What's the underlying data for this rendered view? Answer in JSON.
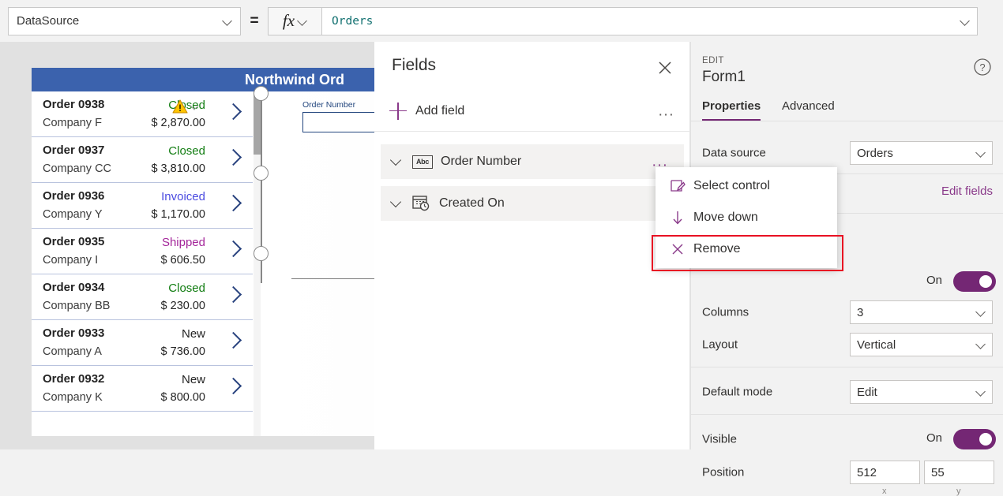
{
  "formula_bar": {
    "property_selector": "DataSource",
    "equals": "=",
    "fx_label": "fx",
    "formula_value": "Orders"
  },
  "canvas": {
    "gallery_title": "Northwind Ord",
    "gallery_rows": [
      {
        "order": "Order 0938",
        "company": "Company F",
        "status": "Closed",
        "status_color": "#107c10",
        "amount": "$ 2,870.00",
        "has_warning": true
      },
      {
        "order": "Order 0937",
        "company": "Company CC",
        "status": "Closed",
        "status_color": "#107c10",
        "amount": "$ 3,810.00",
        "has_warning": false
      },
      {
        "order": "Order 0936",
        "company": "Company Y",
        "status": "Invoiced",
        "status_color": "#4a4ae0",
        "amount": "$ 1,170.00",
        "has_warning": false
      },
      {
        "order": "Order 0935",
        "company": "Company I",
        "status": "Shipped",
        "status_color": "#a4269a",
        "amount": "$ 606.50",
        "has_warning": false
      },
      {
        "order": "Order 0934",
        "company": "Company BB",
        "status": "Closed",
        "status_color": "#107c10",
        "amount": "$ 230.00",
        "has_warning": false
      },
      {
        "order": "Order 0933",
        "company": "Company A",
        "status": "New",
        "status_color": "#242424",
        "amount": "$ 736.00",
        "has_warning": false
      },
      {
        "order": "Order 0932",
        "company": "Company K",
        "status": "New",
        "status_color": "#242424",
        "amount": "$ 800.00",
        "has_warning": false
      }
    ],
    "form": {
      "field_label": "Order Number",
      "field_value": ""
    }
  },
  "fields_panel": {
    "title": "Fields",
    "close_icon": "close-icon",
    "add_field_label": "Add field",
    "ellipsis": "...",
    "items": [
      {
        "name": "Order Number",
        "icon": "text-abc-icon"
      },
      {
        "name": "Created On",
        "icon": "calendar-clock-icon"
      }
    ]
  },
  "context_menu": {
    "items": [
      {
        "label": "Select control",
        "icon": "select-control-icon"
      },
      {
        "label": "Move down",
        "icon": "arrow-down-icon"
      },
      {
        "label": "Remove",
        "icon": "close-x-icon",
        "highlighted": true
      }
    ],
    "highlight_color": "#e81123"
  },
  "properties_panel": {
    "kicker": "EDIT",
    "control_name": "Form1",
    "help_icon": "help-icon",
    "tabs": [
      {
        "label": "Properties",
        "active": true
      },
      {
        "label": "Advanced",
        "active": false
      }
    ],
    "rows": {
      "data_source_label": "Data source",
      "data_source_value": "Orders",
      "edit_fields_link": "Edit fields",
      "snap_toggle_state": "On",
      "columns_label": "Columns",
      "columns_value": "3",
      "layout_label": "Layout",
      "layout_value": "Vertical",
      "default_mode_label": "Default mode",
      "default_mode_value": "Edit",
      "visible_label": "Visible",
      "visible_state": "On",
      "position_label": "Position",
      "position_x": "512",
      "position_y": "55",
      "position_x_axis": "x",
      "position_y_axis": "y"
    },
    "accent_color": "#742774",
    "link_color": "#8a3a8a"
  }
}
